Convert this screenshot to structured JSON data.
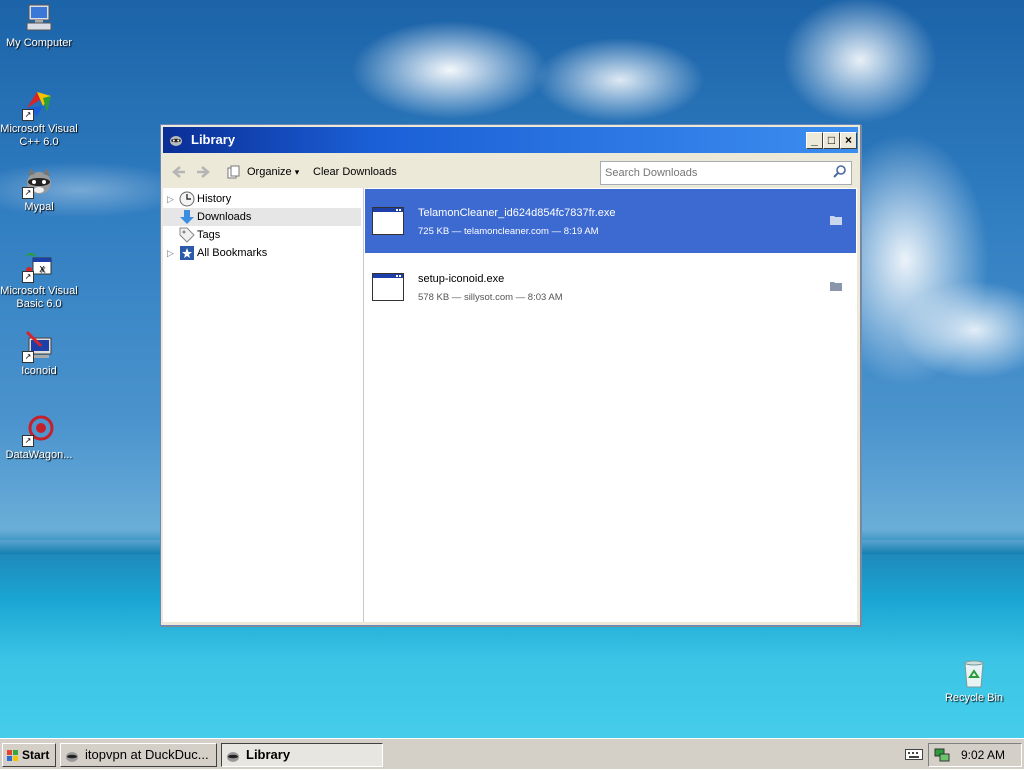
{
  "desktop": {
    "icons": [
      {
        "label": "My Computer",
        "icon": "my-computer-icon"
      },
      {
        "label": "Microsoft Visual C++ 6.0",
        "icon": "visual-cpp-icon"
      },
      {
        "label": "Mypal",
        "icon": "mypal-raccoon-icon"
      },
      {
        "label": "Microsoft Visual Basic 6.0",
        "icon": "visual-basic-icon"
      },
      {
        "label": "Iconoid",
        "icon": "iconoid-icon"
      },
      {
        "label": "DataWagon...",
        "icon": "datawagon-icon"
      },
      {
        "label": "Recycle Bin",
        "icon": "recycle-bin-icon"
      }
    ]
  },
  "window": {
    "title": "Library",
    "controls": {
      "minimize": "_",
      "maximize": "□",
      "close": "×"
    },
    "toolbar": {
      "organize_label": "Organize",
      "organize_arrow": "▾",
      "clear_label": "Clear Downloads",
      "search_placeholder": "Search Downloads"
    },
    "sidebar": {
      "items": [
        {
          "label": "History",
          "icon": "clock-icon",
          "expandable": true
        },
        {
          "label": "Downloads",
          "icon": "download-arrow-icon",
          "selected": true
        },
        {
          "label": "Tags",
          "icon": "tag-icon"
        },
        {
          "label": "All Bookmarks",
          "icon": "bookmarks-star-icon",
          "expandable": true
        }
      ]
    },
    "downloads": [
      {
        "name": "TelamonCleaner_id624d854fc7837fr.exe",
        "meta": "725 KB — telamoncleaner.com — 8:19 AM",
        "selected": true
      },
      {
        "name": "setup-iconoid.exe",
        "meta": "578 KB — sillysot.com — 8:03 AM",
        "selected": false
      }
    ]
  },
  "taskbar": {
    "start_label": "Start",
    "tasks": [
      {
        "label": "itopvpn at DuckDuc...",
        "active": false
      },
      {
        "label": "Library",
        "active": true
      }
    ],
    "clock": "9:02 AM"
  },
  "colors": {
    "title_bar_start": "#0a2e96",
    "title_bar_end": "#3c8ef0",
    "selection": "#3d6ad1",
    "window_face": "#ece9d8",
    "taskbar_face": "#d4d0c8"
  }
}
